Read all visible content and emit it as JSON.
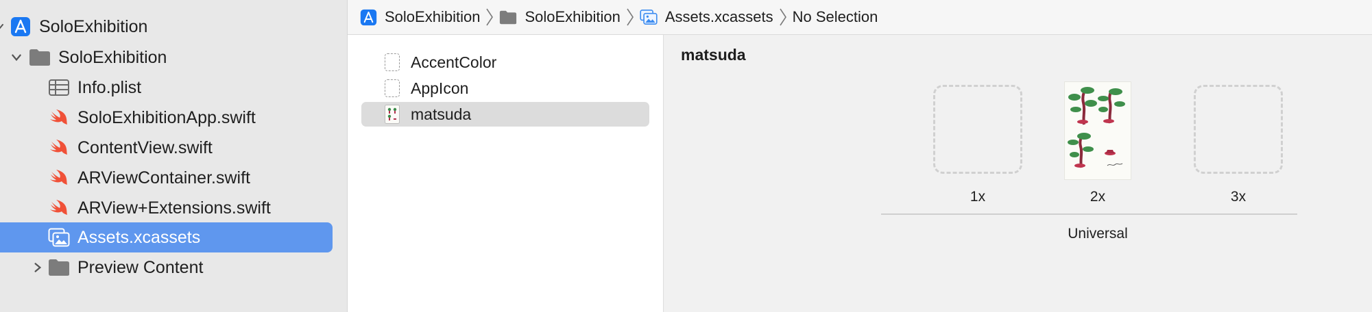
{
  "sidebar": {
    "project": "SoloExhibition",
    "group": "SoloExhibition",
    "files": [
      {
        "label": "Info.plist",
        "icon": "table-icon"
      },
      {
        "label": "SoloExhibitionApp.swift",
        "icon": "swift-icon"
      },
      {
        "label": "ContentView.swift",
        "icon": "swift-icon"
      },
      {
        "label": "ARViewContainer.swift",
        "icon": "swift-icon"
      },
      {
        "label": "ARView+Extensions.swift",
        "icon": "swift-icon"
      },
      {
        "label": "Assets.xcassets",
        "icon": "asset-catalog-icon",
        "selected": true
      }
    ],
    "preview_group": "Preview Content"
  },
  "jumpbar": {
    "crumbs": [
      "SoloExhibition",
      "SoloExhibition",
      "Assets.xcassets",
      "No Selection"
    ]
  },
  "assets": {
    "items": [
      {
        "label": "AccentColor",
        "icon": "color-set-icon"
      },
      {
        "label": "AppIcon",
        "icon": "app-icon-set-icon"
      },
      {
        "label": "matsuda",
        "icon": "image-set-icon",
        "selected": true
      }
    ]
  },
  "detail": {
    "title": "matsuda",
    "slots": [
      "1x",
      "2x",
      "3x"
    ],
    "group_label": "Universal"
  },
  "colors": {
    "selection": "#5f97ee",
    "swift": "#f05138",
    "folder": "#7c7c7c",
    "xcode_blue": "#1a78f2"
  }
}
